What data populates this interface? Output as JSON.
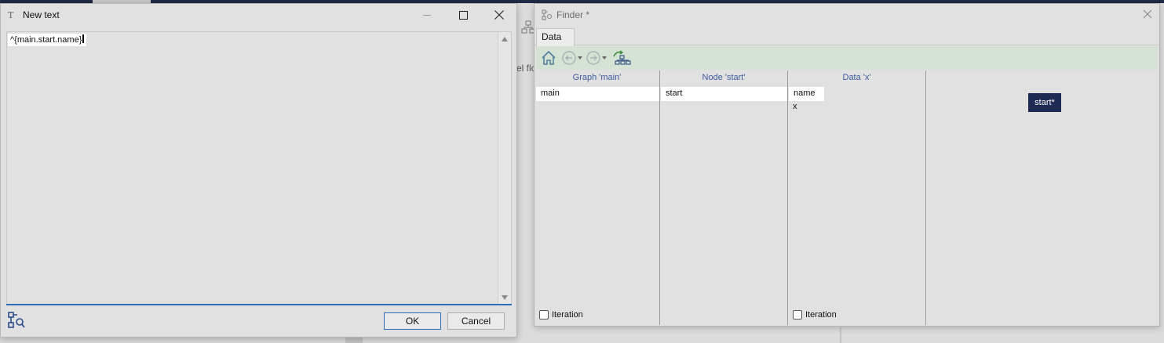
{
  "background": {
    "partial_label": "el flo"
  },
  "text_dialog": {
    "title": "New text",
    "title_icon": "T",
    "editor_value": "^{main.start.name}",
    "ok_label": "OK",
    "cancel_label": "Cancel"
  },
  "finder": {
    "title": "Finder *",
    "tab_label": "Data",
    "toolbar": [
      "home-icon",
      "back-icon",
      "forward-icon",
      "graph-refresh-icon"
    ],
    "columns": [
      {
        "header": "Graph 'main'",
        "selected": "main",
        "items": [],
        "iteration_label": "Iteration"
      },
      {
        "header": "Node 'start'",
        "selected": "start",
        "items": []
      },
      {
        "header": "Data 'x'",
        "selected": "name",
        "items": [
          "x"
        ],
        "iteration_label": "Iteration"
      }
    ],
    "node_badge": "start*"
  },
  "colors": {
    "accent": "#2a6fb5",
    "node_badge_bg": "#1e2a52",
    "column_header": "#3d5a9e",
    "toolbar_bg": "#d4e3d4"
  }
}
